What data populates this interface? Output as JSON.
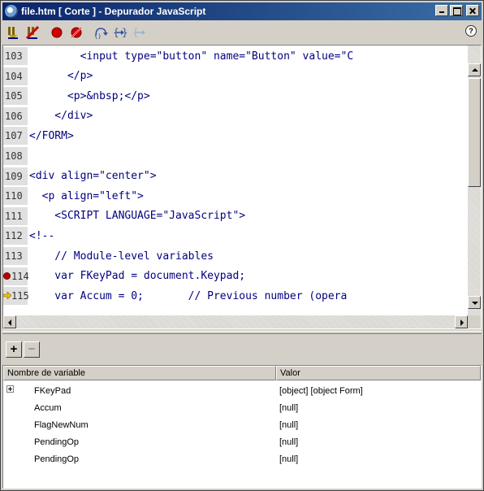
{
  "window": {
    "title": "file.htm [ Corte ] - Depurador JavaScript"
  },
  "toolbar": {
    "help_label": "?"
  },
  "code": {
    "lines": [
      {
        "num": "103",
        "text": "        <input type=\"button\" name=\"Button\" value=\"C",
        "marker": ""
      },
      {
        "num": "104",
        "text": "      </p>",
        "marker": ""
      },
      {
        "num": "105",
        "text": "      <p>&nbsp;</p>",
        "marker": ""
      },
      {
        "num": "106",
        "text": "    </div>",
        "marker": ""
      },
      {
        "num": "107",
        "text": "</FORM>",
        "marker": ""
      },
      {
        "num": "108",
        "text": "",
        "marker": ""
      },
      {
        "num": "109",
        "text": "<div align=\"center\">",
        "marker": ""
      },
      {
        "num": "110",
        "text": "  <p align=\"left\">",
        "marker": ""
      },
      {
        "num": "111",
        "text": "    <SCRIPT LANGUAGE=\"JavaScript\">",
        "marker": ""
      },
      {
        "num": "112",
        "text": "<!--",
        "marker": ""
      },
      {
        "num": "113",
        "text": "    // Module-level variables",
        "marker": ""
      },
      {
        "num": "114",
        "text": "    var FKeyPad = document.Keypad;",
        "marker": "breakpoint"
      },
      {
        "num": "115",
        "text": "    var Accum = 0;       // Previous number (opera",
        "marker": "current"
      }
    ]
  },
  "variables": {
    "add_label": "+",
    "remove_label": "−",
    "headers": {
      "name": "Nombre de variable",
      "value": "Valor"
    },
    "rows": [
      {
        "name": "FKeyPad",
        "value": "[object] [object Form]",
        "expandable": true
      },
      {
        "name": "Accum",
        "value": "[null]",
        "expandable": false
      },
      {
        "name": "FlagNewNum",
        "value": "[null]",
        "expandable": false
      },
      {
        "name": "PendingOp",
        "value": "[null]",
        "expandable": false
      },
      {
        "name": "PendingOp",
        "value": "[null]",
        "expandable": false
      }
    ]
  },
  "colors": {
    "titlebar": "#0a246a",
    "code_text": "#000080",
    "breakpoint": "#c00000"
  }
}
